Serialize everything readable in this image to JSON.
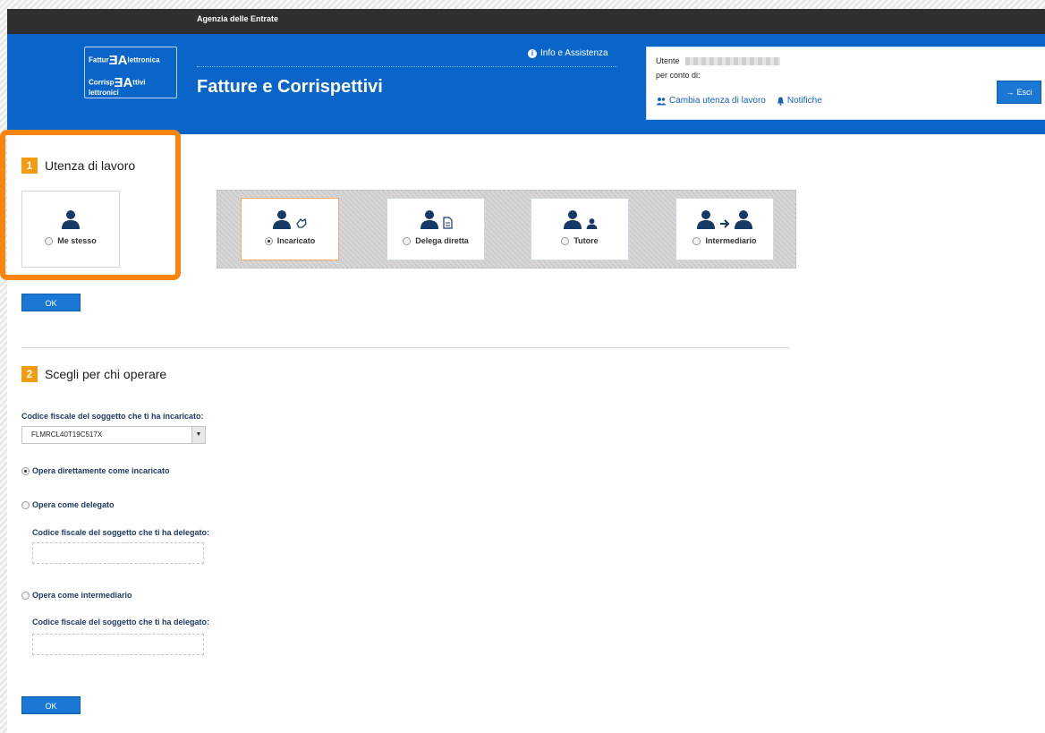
{
  "topbar": {
    "title": "Agenzia delle Entrate"
  },
  "header": {
    "logo": {
      "line1": "Fattur",
      "line1_end": "lettronica",
      "line2": "Corrisp",
      "line2_mid": "ttivi",
      "line2_end": "lettronici",
      "glyph": "ƎA"
    },
    "title": "Fatture e Corrispettivi",
    "info_link": "Info e Assistenza",
    "info_icon_glyph": "i",
    "user": {
      "utente_label": "Utente",
      "per_conto_label": "per conto di:",
      "cambia_link": "Cambia utenza di lavoro",
      "notifiche_link": "Notifiche"
    },
    "logout_label": "Esci",
    "logout_icon": "→"
  },
  "step1": {
    "number": "1",
    "title": "Utenza di lavoro",
    "cards": [
      {
        "label": "Me stesso",
        "selected": false,
        "icon": "person-icon"
      },
      {
        "label": "Incaricato",
        "selected": true,
        "icon": "person-hand-icon"
      },
      {
        "label": "Delega diretta",
        "selected": false,
        "icon": "person-document-icon"
      },
      {
        "label": "Tutore",
        "selected": false,
        "icon": "person-child-icon"
      },
      {
        "label": "Intermediario",
        "selected": false,
        "icon": "person-arrow-person-icon"
      }
    ],
    "ok_label": "OK"
  },
  "step2": {
    "number": "2",
    "title": "Scegli per chi operare",
    "incaricato_label": "Codice fiscale del soggetto che ti ha incaricato:",
    "incaricato_value": "FLMRCL40T19C517X",
    "select_arrow": "▼",
    "options": [
      {
        "label": "Opera direttamente come incaricato",
        "selected": true
      },
      {
        "label": "Opera come delegato",
        "selected": false,
        "field_label": "Codice fiscale del soggetto che ti ha delegato:"
      },
      {
        "label": "Opera come intermediario",
        "selected": false,
        "field_label": "Codice fiscale del soggetto che ti ha delegato:"
      }
    ],
    "ok_label": "OK"
  },
  "colors": {
    "header_blue": "#0a65c8",
    "topbar": "#2e2f31",
    "accent_orange": "#f39c12",
    "highlight_orange": "#f7850f",
    "button_blue": "#1a77d4"
  }
}
